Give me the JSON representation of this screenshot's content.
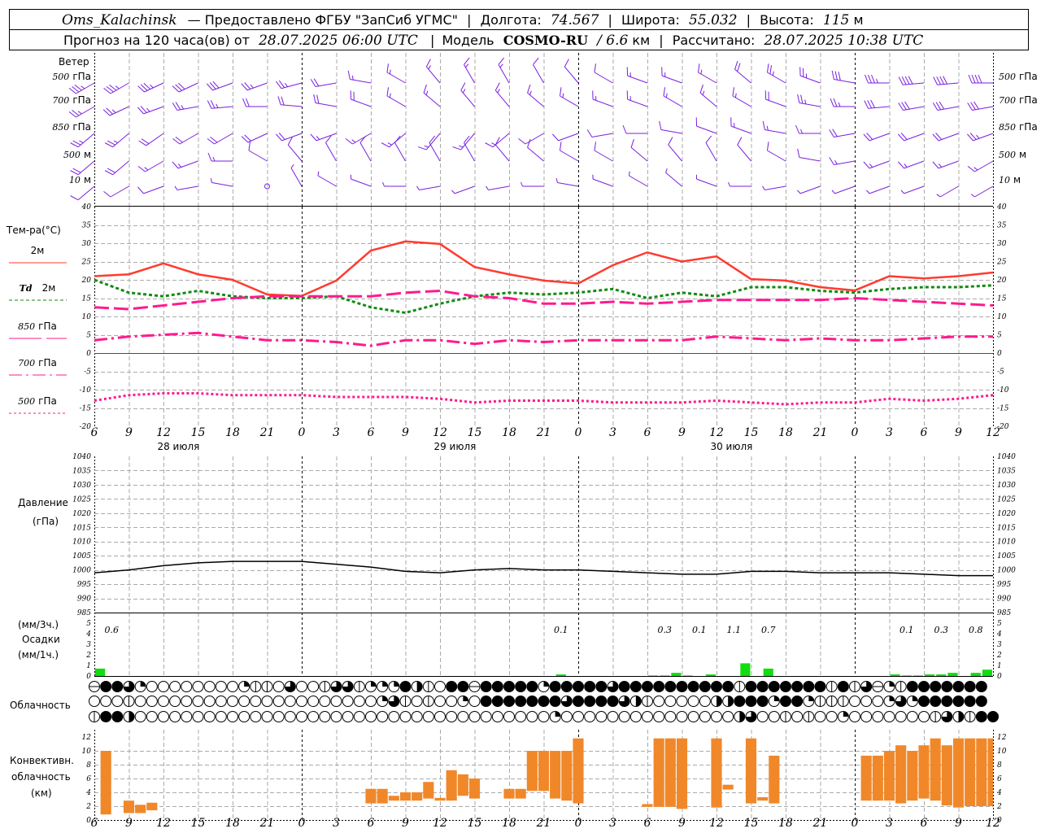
{
  "header": {
    "station": "Oms_Kalachinsk",
    "provider": "— Предоставлено ФГБУ \"ЗапСиб УГМС\"",
    "lon_label": "Долгота:",
    "lon": "74.567",
    "lat_label": "Широта:",
    "lat": "55.032",
    "alt_label": "Высота:",
    "alt": "115",
    "alt_unit": "м",
    "forecast_prefix": "Прогноз на 120 часа(ов) от",
    "forecast_time": "28.07.2025 06:00 UTC",
    "model_label": "Модель",
    "model": "COSMO-RU",
    "resolution": "/ 6.6",
    "res_unit": "км",
    "calc_label": "Рассчитано:",
    "calc_time": "28.07.2025 10:38 UTC"
  },
  "time_axis": {
    "hour_labels": [
      "6",
      "9",
      "12",
      "15",
      "18",
      "21",
      "0",
      "3",
      "6",
      "9",
      "12",
      "15",
      "18",
      "21",
      "0",
      "3",
      "6",
      "9",
      "12",
      "15",
      "18",
      "21",
      "0",
      "3",
      "6",
      "9",
      "12"
    ],
    "day_labels": [
      "28 июля",
      "29 июля",
      "30 июля"
    ]
  },
  "wind": {
    "title": "Ветер",
    "color": "#7a1fe0",
    "levels": [
      {
        "label": "500 гПа",
        "num": "500",
        "unit": "гПа",
        "dir": [
          240,
          240,
          245,
          245,
          250,
          250,
          255,
          260,
          280,
          300,
          320,
          330,
          330,
          330,
          320,
          300,
          290,
          290,
          300,
          310,
          300,
          290,
          280,
          270,
          265,
          265,
          270
        ],
        "speed": [
          18,
          18,
          17,
          16,
          15,
          14,
          12,
          10,
          9,
          8,
          8,
          7,
          7,
          6,
          6,
          6,
          7,
          8,
          9,
          10,
          12,
          14,
          16,
          18,
          20,
          20,
          20
        ]
      },
      {
        "label": "700 гПа",
        "num": "700",
        "unit": "гПа",
        "dir": [
          240,
          245,
          250,
          260,
          265,
          270,
          275,
          280,
          290,
          300,
          310,
          320,
          320,
          310,
          300,
          290,
          290,
          300,
          310,
          300,
          290,
          280,
          270,
          265,
          260,
          260,
          260
        ],
        "speed": [
          12,
          13,
          13,
          12,
          12,
          11,
          11,
          10,
          10,
          9,
          8,
          7,
          7,
          7,
          8,
          8,
          8,
          8,
          8,
          9,
          10,
          12,
          14,
          15,
          15,
          16,
          16
        ]
      },
      {
        "label": "850 гПа",
        "num": "850",
        "unit": "гПа",
        "dir": [
          230,
          230,
          235,
          240,
          240,
          245,
          250,
          250,
          240,
          230,
          220,
          220,
          230,
          240,
          250,
          260,
          270,
          280,
          290,
          290,
          280,
          270,
          260,
          250,
          250,
          250,
          250
        ],
        "speed": [
          12,
          12,
          11,
          11,
          10,
          10,
          10,
          9,
          8,
          7,
          7,
          7,
          7,
          6,
          6,
          6,
          6,
          6,
          6,
          7,
          8,
          9,
          10,
          10,
          11,
          11,
          12
        ]
      },
      {
        "label": "500 м",
        "num": "500",
        "unit": "м",
        "dir": [
          230,
          230,
          240,
          250,
          270,
          300,
          320,
          330,
          330,
          330,
          330,
          330,
          320,
          310,
          300,
          300,
          310,
          320,
          330,
          320,
          300,
          280,
          260,
          250,
          250,
          250,
          240
        ],
        "speed": [
          10,
          10,
          9,
          8,
          7,
          6,
          6,
          6,
          6,
          6,
          5,
          5,
          5,
          5,
          5,
          6,
          6,
          6,
          5,
          5,
          5,
          6,
          7,
          7,
          8,
          8,
          8
        ]
      },
      {
        "label": "10 м",
        "num": "10",
        "unit": "м",
        "dir": [
          230,
          240,
          250,
          260,
          280,
          0,
          330,
          300,
          290,
          270,
          260,
          250,
          260,
          270,
          280,
          290,
          300,
          310,
          290,
          270,
          260,
          250,
          250,
          250,
          250,
          240,
          240
        ],
        "speed": [
          5,
          5,
          5,
          4,
          3,
          0,
          3,
          3,
          3,
          3,
          3,
          3,
          3,
          3,
          2,
          2,
          2,
          3,
          3,
          3,
          3,
          3,
          3,
          3,
          3,
          3,
          3
        ]
      }
    ]
  },
  "temperature": {
    "title": "Тем-ра(°C)",
    "ylim": [
      -20,
      40
    ],
    "ticks": [
      "40",
      "35",
      "30",
      "25",
      "20",
      "15",
      "10",
      "5",
      "0",
      "-5",
      "-10",
      "-15",
      "-20"
    ],
    "zero_line_color": "#2040ff",
    "series": [
      {
        "name": "2м",
        "prefix": "",
        "color": "#ff3b30",
        "style": "solid",
        "values": [
          21,
          21.5,
          24.5,
          21.5,
          20,
          16,
          15.6,
          19.8,
          28,
          30.5,
          29.8,
          23.5,
          21.5,
          19.8,
          19,
          24,
          27.5,
          25,
          26.4,
          20.2,
          19.8,
          18,
          17.1,
          21,
          20.4,
          21,
          22
        ]
      },
      {
        "name": "2м",
        "prefix": "Td",
        "color": "#138a13",
        "style": "dotted",
        "values": [
          20,
          16.5,
          15.5,
          17,
          15.5,
          15,
          15,
          15.5,
          12.5,
          11,
          13.5,
          15.5,
          16.5,
          16,
          16.5,
          17.5,
          15,
          16.5,
          15.5,
          18,
          18,
          17,
          16.5,
          17.5,
          18,
          18,
          18.5
        ]
      },
      {
        "name": "гПа",
        "prefix": "850",
        "color": "#ff1a8c",
        "style": "dash",
        "values": [
          12.5,
          12,
          13,
          14,
          15,
          15.5,
          15.5,
          15.5,
          15.5,
          16.5,
          17,
          15.5,
          15,
          13.5,
          13.5,
          14,
          13.5,
          14,
          14.5,
          14.5,
          14.5,
          14.5,
          15,
          14.5,
          14,
          13.5,
          13
        ]
      },
      {
        "name": "гПа",
        "prefix": "700",
        "color": "#ff1a8c",
        "style": "dashdot",
        "values": [
          3.5,
          4.5,
          5,
          5.5,
          4.5,
          3.5,
          3.5,
          3,
          2,
          3.5,
          3.5,
          2.5,
          3.5,
          3,
          3.5,
          3.5,
          3.5,
          3.5,
          4.5,
          4,
          3.5,
          4,
          3.5,
          3.5,
          4,
          4.5,
          4.5
        ]
      },
      {
        "name": "гПа",
        "prefix": "500",
        "color": "#ff1a8c",
        "style": "dot",
        "values": [
          -13,
          -11.5,
          -11,
          -11,
          -11.5,
          -11.5,
          -11.5,
          -12,
          -12,
          -12,
          -12.5,
          -13.5,
          -13,
          -13,
          -13,
          -13.5,
          -13.5,
          -13.5,
          -13,
          -13.5,
          -14,
          -13.5,
          -13.5,
          -12.5,
          -13,
          -12.5,
          -11.5
        ]
      }
    ]
  },
  "pressure": {
    "title": "Давление",
    "unit": "(гПа)",
    "ylim": [
      985,
      1040
    ],
    "ticks": [
      "1040",
      "1035",
      "1030",
      "1025",
      "1020",
      "1015",
      "1010",
      "1005",
      "1000",
      "995",
      "990",
      "985"
    ],
    "values": [
      999,
      1000,
      1001.5,
      1002.5,
      1003,
      1003,
      1003,
      1002,
      1001,
      999.5,
      999,
      1000,
      1000.5,
      1000,
      1000,
      999.5,
      999,
      998.5,
      998.5,
      999.5,
      999.5,
      999,
      999,
      999,
      998.5,
      998,
      998
    ]
  },
  "precipitation": {
    "unit_3h": "(мм/3ч.)",
    "title": "Осадки",
    "unit_1h": "(мм/1ч.)",
    "ylim": [
      0,
      5
    ],
    "ticks": [
      "5",
      "4",
      "3",
      "2",
      "1",
      "0"
    ],
    "bar_color": "#11dd11",
    "hourly": [
      [
        0,
        0.7
      ],
      [
        40,
        0.15
      ],
      [
        48,
        0.05
      ],
      [
        49,
        0.05
      ],
      [
        50,
        0.3
      ],
      [
        51,
        0.05
      ],
      [
        53,
        0.15
      ],
      [
        56,
        1.2
      ],
      [
        58,
        0.7
      ],
      [
        69,
        0.15
      ],
      [
        70,
        0.05
      ],
      [
        71,
        0.05
      ],
      [
        72,
        0.15
      ],
      [
        73,
        0.15
      ],
      [
        74,
        0.3
      ],
      [
        76,
        0.3
      ],
      [
        77,
        0.6
      ]
    ],
    "totals": [
      [
        1.5,
        "0.6"
      ],
      [
        40.5,
        "0.1"
      ],
      [
        49.5,
        "0.3"
      ],
      [
        52.5,
        "0.1"
      ],
      [
        55.5,
        "1.1"
      ],
      [
        58.5,
        "0.7"
      ],
      [
        70.5,
        "0.1"
      ],
      [
        73.5,
        "0.3"
      ],
      [
        76.5,
        "0.8"
      ]
    ]
  },
  "cloudiness": {
    "title": "Облачность",
    "rows": [
      "efftq00000000qvv0t00vttvqqqfhv0ffefffffqffffftffffffffffvfffffffvfvteqvfffffff",
      "000v000000000000000000000qtv0v00q0ffffffftffffthv00000hhfffqffqvvv000qtqffffff",
      "vffh000000000000000000000000000000000000q000000000000000ht00v0v00q0000000vthvff"
    ]
  },
  "convective": {
    "title_1": "Конвективн.",
    "title_2": "облачность",
    "title_3": "(км)",
    "ylim": [
      0,
      12
    ],
    "ticks": [
      "12",
      "10",
      "8",
      "6",
      "4",
      "2",
      "0"
    ],
    "bar_color": "#f0882a",
    "bars": [
      [
        1,
        0.8,
        10
      ],
      [
        3,
        1,
        2.8
      ],
      [
        4,
        1,
        2.2
      ],
      [
        5,
        1.4,
        2.5
      ],
      [
        24,
        2.4,
        4.5
      ],
      [
        25,
        2.4,
        4.5
      ],
      [
        26,
        2.8,
        3.5
      ],
      [
        27,
        2.8,
        4
      ],
      [
        28,
        2.8,
        4
      ],
      [
        29,
        3.1,
        5.5
      ],
      [
        30,
        2.8,
        3.2
      ],
      [
        31,
        2.8,
        7.2
      ],
      [
        32,
        3.5,
        6.6
      ],
      [
        33,
        3.1,
        6
      ],
      [
        36,
        3.1,
        4.5
      ],
      [
        37,
        3.1,
        4.5
      ],
      [
        38,
        4.2,
        10
      ],
      [
        39,
        4.2,
        10
      ],
      [
        40,
        3.1,
        10
      ],
      [
        41,
        2.8,
        10
      ],
      [
        42,
        2.4,
        11.8
      ],
      [
        48,
        1.9,
        2.3
      ],
      [
        49,
        1.9,
        11.8
      ],
      [
        50,
        1.9,
        11.8
      ],
      [
        51,
        1.6,
        11.8
      ],
      [
        54,
        1.8,
        11.8
      ],
      [
        55,
        4.4,
        5.1
      ],
      [
        57,
        2.4,
        11.8
      ],
      [
        58,
        2.8,
        3.3
      ],
      [
        59,
        2.4,
        9.3
      ],
      [
        67,
        2.8,
        9.3
      ],
      [
        68,
        2.8,
        9.3
      ],
      [
        69,
        2.8,
        10
      ],
      [
        70,
        2.4,
        10.8
      ],
      [
        71,
        2.8,
        10
      ],
      [
        72,
        3.1,
        10.8
      ],
      [
        73,
        2.8,
        11.8
      ],
      [
        74,
        2.1,
        10.8
      ],
      [
        75,
        1.8,
        11.8
      ],
      [
        76,
        2,
        11.8
      ],
      [
        77,
        2,
        11.8
      ],
      [
        78,
        2,
        11.8
      ]
    ]
  }
}
